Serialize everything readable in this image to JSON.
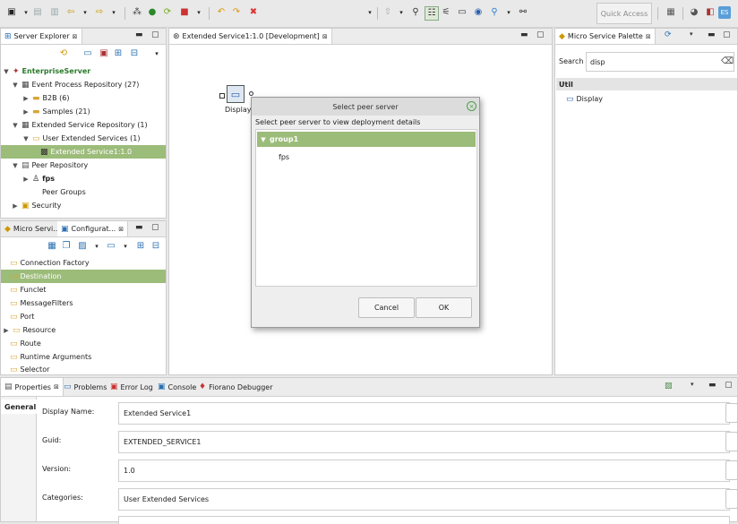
{
  "toolbar": {
    "quick_access": "Quick Access"
  },
  "server_explorer": {
    "tab_label": "Server Explorer",
    "tree": [
      {
        "label": "EnterpriseServer"
      },
      {
        "label": "Event Process Repository (27)"
      },
      {
        "label": "B2B (6)"
      },
      {
        "label": "Samples (21)"
      },
      {
        "label": "Extended Service Repository (1)"
      },
      {
        "label": "User Extended Services (1)"
      },
      {
        "label": "Extended Service1:1.0"
      },
      {
        "label": "Peer Repository"
      },
      {
        "label": "fps"
      },
      {
        "label": "Peer Groups"
      },
      {
        "label": "Security"
      }
    ]
  },
  "config_panel": {
    "tab_micro": "Micro Servi...",
    "tab_config": "Configurat...",
    "items": [
      {
        "label": "Connection Factory"
      },
      {
        "label": "Destination"
      },
      {
        "label": "Funclet"
      },
      {
        "label": "MessageFilters"
      },
      {
        "label": "Port"
      },
      {
        "label": "Resource"
      },
      {
        "label": "Route"
      },
      {
        "label": "Runtime Arguments"
      },
      {
        "label": "Selector"
      }
    ]
  },
  "editor": {
    "tab_label": "Extended Service1:1.0 [Development]",
    "node_label": "Display1"
  },
  "palette": {
    "tab_label": "Micro Service Palette",
    "search_label": "Search",
    "search_value": "disp",
    "category": "Util",
    "item": "Display"
  },
  "dialog": {
    "title": "Select peer server",
    "subtitle": "Select peer server to view deployment details",
    "group": "group1",
    "peer": "fps",
    "cancel": "Cancel",
    "ok": "OK"
  },
  "bottom_tabs": {
    "properties": "Properties",
    "problems": "Problems",
    "error_log": "Error Log",
    "console": "Console",
    "debugger": "Fiorano Debugger"
  },
  "properties": {
    "section": "General",
    "fields": [
      {
        "label": "Display Name:",
        "value": "Extended Service1"
      },
      {
        "label": "Guid:",
        "value": "EXTENDED_SERVICE1"
      },
      {
        "label": "Version:",
        "value": "1.0"
      },
      {
        "label": "Categories:",
        "value": "User Extended Services"
      }
    ]
  }
}
